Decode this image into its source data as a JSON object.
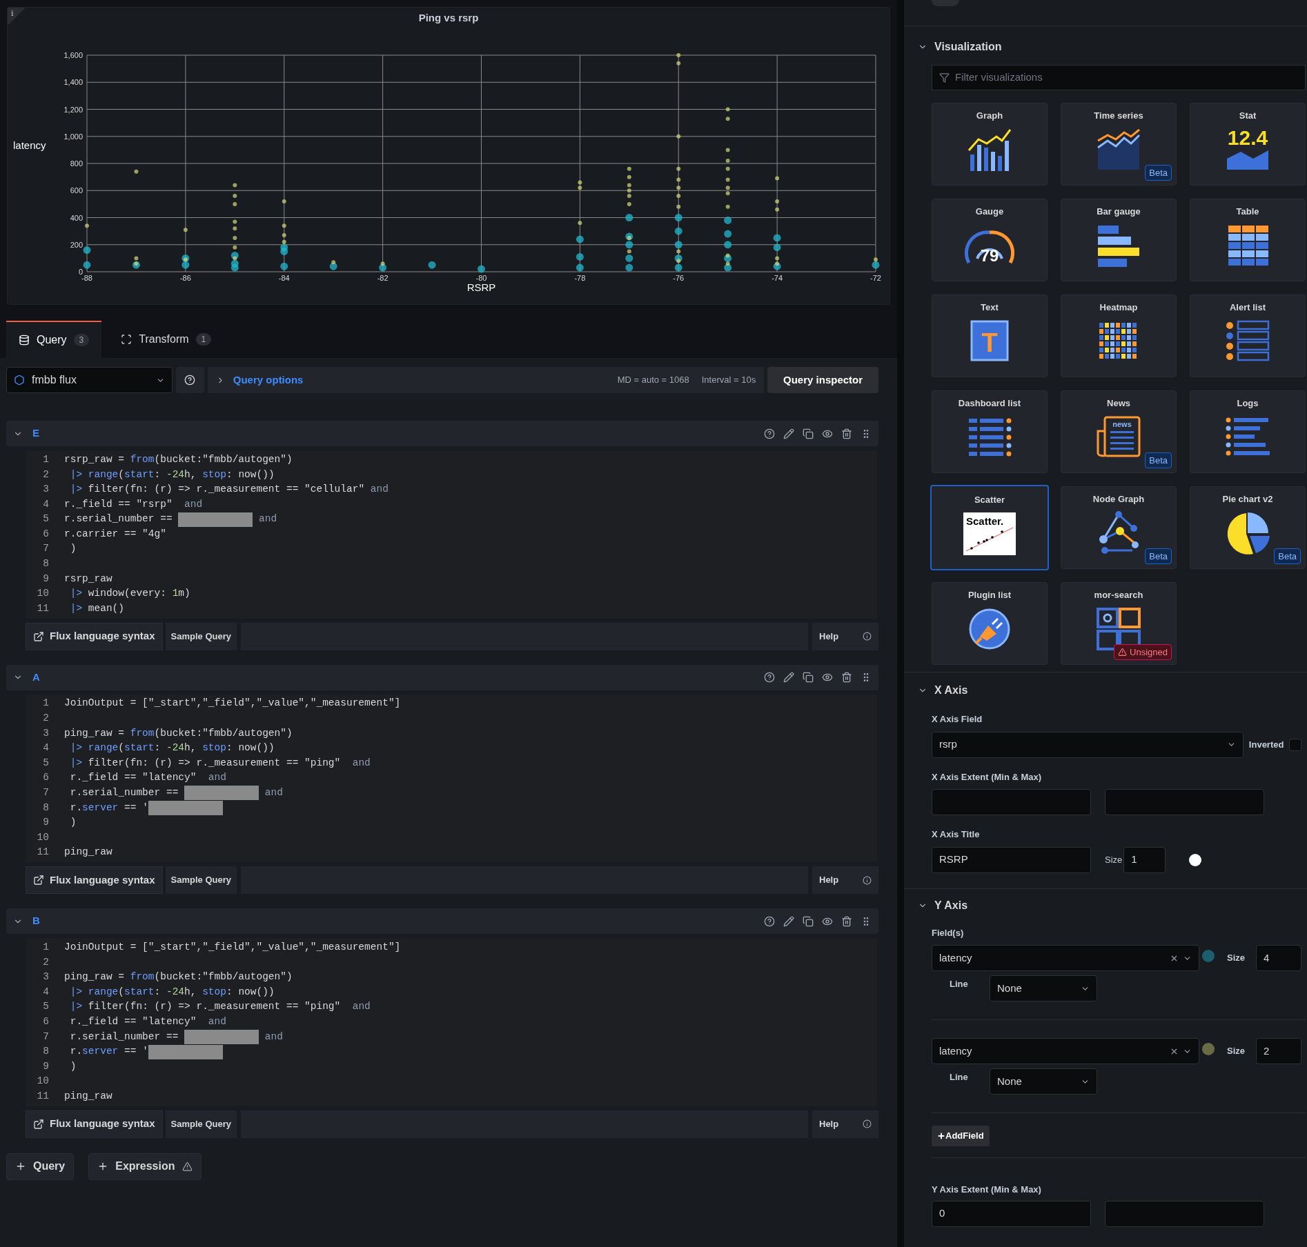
{
  "panel": {
    "info_mark": "i",
    "title": "Ping vs rsrp",
    "chart_data": {
      "type": "scatter",
      "xlabel": "RSRP",
      "ylabel": "latency",
      "grid": true,
      "xlim": [
        -88,
        -72
      ],
      "ylim": [
        0,
        1600
      ],
      "xticks": [
        -88,
        -86,
        -84,
        -82,
        -80,
        -78,
        -76,
        -74,
        -72
      ],
      "yticks": [
        {
          "value": 0,
          "label": "0"
        },
        {
          "value": 200,
          "label": "200"
        },
        {
          "value": 400,
          "label": "400"
        },
        {
          "value": 600,
          "label": "600"
        },
        {
          "value": 800,
          "label": "800"
        },
        {
          "value": 1000,
          "label": "1,000"
        },
        {
          "value": 1200,
          "label": "1,200"
        },
        {
          "value": 1400,
          "label": "1,400"
        },
        {
          "value": 1600,
          "label": "1,600"
        }
      ],
      "series": [
        {
          "color": "#22b8cf",
          "x": [
            -88,
            -88,
            -87,
            -86,
            -86,
            -85,
            -85,
            -85,
            -84,
            -84,
            -84,
            -83,
            -82,
            -81,
            -80,
            -78,
            -78,
            -78,
            -77,
            -77,
            -77,
            -77,
            -77,
            -76,
            -76,
            -76,
            -76,
            -76,
            -75,
            -75,
            -75,
            -75,
            -75,
            -74,
            -74,
            -74,
            -72
          ],
          "values": [
            50,
            160,
            50,
            50,
            100,
            30,
            60,
            120,
            40,
            150,
            180,
            40,
            30,
            50,
            20,
            30,
            110,
            240,
            30,
            100,
            200,
            260,
            400,
            30,
            100,
            200,
            300,
            400,
            30,
            100,
            200,
            280,
            380,
            40,
            180,
            250,
            50
          ]
        },
        {
          "color": "#d4d87e",
          "x": [
            -88,
            -87,
            -87,
            -87,
            -86,
            -86,
            -85,
            -85,
            -85,
            -85,
            -85,
            -85,
            -85,
            -85,
            -84,
            -84,
            -84,
            -84,
            -83,
            -82,
            -78,
            -78,
            -78,
            -77,
            -77,
            -77,
            -77,
            -77,
            -77,
            -77,
            -77,
            -76,
            -76,
            -76,
            -76,
            -76,
            -76,
            -76,
            -76,
            -76,
            -76,
            -75,
            -75,
            -75,
            -75,
            -75,
            -75,
            -75,
            -75,
            -75,
            -75,
            -75,
            -74,
            -74,
            -74,
            -74,
            -74,
            -72
          ],
          "values": [
            340,
            740,
            100,
            60,
            310,
            90,
            640,
            560,
            500,
            370,
            320,
            250,
            180,
            100,
            520,
            340,
            270,
            220,
            70,
            60,
            660,
            620,
            360,
            760,
            700,
            640,
            600,
            560,
            500,
            250,
            150,
            1600,
            1540,
            1000,
            760,
            680,
            620,
            560,
            480,
            150,
            80,
            1200,
            1130,
            900,
            820,
            760,
            680,
            620,
            580,
            480,
            120,
            60,
            690,
            520,
            460,
            100,
            60,
            90
          ]
        }
      ]
    }
  },
  "tabs": [
    {
      "label": "Query",
      "count": "3",
      "selected": true
    },
    {
      "label": "Transform",
      "count": "1",
      "selected": false
    }
  ],
  "datasource": {
    "name": "fmbb flux"
  },
  "query_options": {
    "label": "Query options",
    "expanded": false,
    "md": "MD = auto = 1068",
    "interval": "Interval = 10s",
    "inspector": "Query inspector"
  },
  "queries": [
    {
      "letter": "E",
      "expanded": true,
      "lines": [
        {
          "number": "1",
          "segments": [
            {
              "t": "rsrp_raw = "
            },
            {
              "t": "from",
              "kind": "keyword"
            },
            {
              "t": "(bucket:\"fmbb/autogen\")"
            }
          ]
        },
        {
          "number": "2",
          "segments": [
            {
              "t": " |> range",
              "kind": "keyword"
            },
            {
              "t": "("
            },
            {
              "t": "start",
              "kind": "keyword"
            },
            {
              "t": ": "
            },
            {
              "t": "-24",
              "kind": "number"
            },
            {
              "t": "h, "
            },
            {
              "t": "stop",
              "kind": "keyword"
            },
            {
              "t": ": now())"
            }
          ]
        },
        {
          "number": "3",
          "segments": [
            {
              "t": " |> ",
              "kind": "keyword"
            },
            {
              "t": "filter(fn: (r) => r._measurement == \"cellular\" "
            },
            {
              "t": "and",
              "kind": "muted"
            }
          ]
        },
        {
          "number": "4",
          "segments": [
            {
              "t": "r._field == \"rsrp\"  "
            },
            {
              "t": "and",
              "kind": "muted"
            }
          ]
        },
        {
          "number": "5",
          "segments": [
            {
              "t": "r.serial_number == "
            },
            {
              "kind": "redacted"
            },
            {
              "t": " and",
              "kind": "muted"
            }
          ]
        },
        {
          "number": "6",
          "segments": [
            {
              "t": "r.carrier == \"4g\""
            }
          ]
        },
        {
          "number": "7",
          "segments": [
            {
              "t": " )"
            }
          ]
        },
        {
          "number": "8"
        },
        {
          "number": "9",
          "segments": [
            {
              "t": "rsrp_raw"
            }
          ]
        },
        {
          "number": "10",
          "segments": [
            {
              "t": " |> ",
              "kind": "keyword"
            },
            {
              "t": "window(every: "
            },
            {
              "t": "1",
              "kind": "number"
            },
            {
              "t": "m)"
            }
          ]
        },
        {
          "number": "11",
          "segments": [
            {
              "t": " |> ",
              "kind": "keyword"
            },
            {
              "t": "mean()"
            }
          ]
        }
      ],
      "footer": {
        "syntax": "Flux language syntax",
        "sample": "Sample Query",
        "help": "Help"
      }
    },
    {
      "letter": "A",
      "expanded": true,
      "lines": [
        {
          "number": "1",
          "segments": [
            {
              "t": "JoinOutput = [\"_start\",\"_field\",\"_value\",\"_measurement\"]"
            }
          ]
        },
        {
          "number": "2"
        },
        {
          "number": "3",
          "segments": [
            {
              "t": "ping_raw = "
            },
            {
              "t": "from",
              "kind": "keyword"
            },
            {
              "t": "(bucket:\"fmbb/autogen\")"
            }
          ]
        },
        {
          "number": "4",
          "segments": [
            {
              "t": " |> range",
              "kind": "keyword"
            },
            {
              "t": "("
            },
            {
              "t": "start",
              "kind": "keyword"
            },
            {
              "t": ": "
            },
            {
              "t": "-24",
              "kind": "number"
            },
            {
              "t": "h, "
            },
            {
              "t": "stop",
              "kind": "keyword"
            },
            {
              "t": ": now())"
            }
          ]
        },
        {
          "number": "5",
          "segments": [
            {
              "t": " |> ",
              "kind": "keyword"
            },
            {
              "t": "filter(fn: (r) => r._measurement == \"ping\"  "
            },
            {
              "t": "and",
              "kind": "muted"
            }
          ]
        },
        {
          "number": "6",
          "segments": [
            {
              "t": " r._field == \"latency\"  "
            },
            {
              "t": "and",
              "kind": "muted"
            }
          ]
        },
        {
          "number": "7",
          "segments": [
            {
              "t": " r.serial_number == "
            },
            {
              "kind": "redacted"
            },
            {
              "t": " and",
              "kind": "muted"
            }
          ]
        },
        {
          "number": "8",
          "segments": [
            {
              "t": " r."
            },
            {
              "t": "server",
              "kind": "keyword"
            },
            {
              "t": " == '"
            },
            {
              "kind": "redacted"
            }
          ]
        },
        {
          "number": "9",
          "segments": [
            {
              "t": " )"
            }
          ]
        },
        {
          "number": "10"
        },
        {
          "number": "11",
          "segments": [
            {
              "t": "ping_raw"
            }
          ]
        }
      ],
      "footer": {
        "syntax": "Flux language syntax",
        "sample": "Sample Query",
        "help": "Help"
      }
    },
    {
      "letter": "B",
      "expanded": true,
      "lines": [
        {
          "number": "1",
          "segments": [
            {
              "t": "JoinOutput = [\"_start\",\"_field\",\"_value\",\"_measurement\"]"
            }
          ]
        },
        {
          "number": "2"
        },
        {
          "number": "3",
          "segments": [
            {
              "t": "ping_raw = "
            },
            {
              "t": "from",
              "kind": "keyword"
            },
            {
              "t": "(bucket:\"fmbb/autogen\")"
            }
          ]
        },
        {
          "number": "4",
          "segments": [
            {
              "t": " |> range",
              "kind": "keyword"
            },
            {
              "t": "("
            },
            {
              "t": "start",
              "kind": "keyword"
            },
            {
              "t": ": "
            },
            {
              "t": "-24",
              "kind": "number"
            },
            {
              "t": "h, "
            },
            {
              "t": "stop",
              "kind": "keyword"
            },
            {
              "t": ": now())"
            }
          ]
        },
        {
          "number": "5",
          "segments": [
            {
              "t": " |> ",
              "kind": "keyword"
            },
            {
              "t": "filter(fn: (r) => r._measurement == \"ping\"  "
            },
            {
              "t": "and",
              "kind": "muted"
            }
          ]
        },
        {
          "number": "6",
          "segments": [
            {
              "t": " r._field == \"latency\"  "
            },
            {
              "t": "and",
              "kind": "muted"
            }
          ]
        },
        {
          "number": "7",
          "segments": [
            {
              "t": " r.serial_number == "
            },
            {
              "kind": "redacted"
            },
            {
              "t": " and",
              "kind": "muted"
            }
          ]
        },
        {
          "number": "8",
          "segments": [
            {
              "t": " r."
            },
            {
              "t": "server",
              "kind": "keyword"
            },
            {
              "t": " == '"
            },
            {
              "kind": "redacted"
            }
          ]
        },
        {
          "number": "9",
          "segments": [
            {
              "t": " )"
            }
          ]
        },
        {
          "number": "10"
        },
        {
          "number": "11",
          "segments": [
            {
              "t": "ping_raw"
            }
          ]
        }
      ],
      "footer": {
        "syntax": "Flux language syntax",
        "sample": "Sample Query",
        "help": "Help"
      }
    }
  ],
  "add_buttons": [
    {
      "label": "Query",
      "warning": false
    },
    {
      "label": "Expression",
      "warning": true
    }
  ],
  "options": {
    "top_switch": {
      "on": false
    },
    "visualization": {
      "title": "Visualization",
      "expanded": true,
      "filter_placeholder": "Filter visualizations",
      "cards": [
        {
          "name": "Graph",
          "selected": false
        },
        {
          "name": "Time series",
          "selected": false,
          "badge": {
            "text": "Beta",
            "kind": "beta"
          }
        },
        {
          "name": "Stat",
          "selected": false,
          "icon_text": "12.4"
        },
        {
          "name": "Gauge",
          "selected": false,
          "icon_text": "79"
        },
        {
          "name": "Bar gauge",
          "selected": false
        },
        {
          "name": "Table",
          "selected": false
        },
        {
          "name": "Text",
          "selected": false,
          "icon_text": "T"
        },
        {
          "name": "Heatmap",
          "selected": false
        },
        {
          "name": "Alert list",
          "selected": false
        },
        {
          "name": "Dashboard list",
          "selected": false
        },
        {
          "name": "News",
          "selected": false,
          "icon_text": "news",
          "badge": {
            "text": "Beta",
            "kind": "beta"
          }
        },
        {
          "name": "Logs",
          "selected": false
        },
        {
          "name": "Scatter",
          "selected": true,
          "icon_text": "Scatter."
        },
        {
          "name": "Node Graph",
          "selected": false,
          "badge": {
            "text": "Beta",
            "kind": "beta"
          }
        },
        {
          "name": "Pie chart v2",
          "selected": false,
          "badge": {
            "text": "Beta",
            "kind": "beta"
          }
        },
        {
          "name": "Plugin list",
          "selected": false
        },
        {
          "name": "mor-search",
          "selected": false,
          "badge": {
            "text": "Unsigned",
            "kind": "warning"
          }
        }
      ]
    },
    "x_axis": {
      "title": "X Axis",
      "expanded": true,
      "field_label": "X Axis Field",
      "field": "rsrp",
      "inverted_label": "Inverted",
      "inverted": false,
      "extent_label": "X Axis Extent (Min & Max)",
      "axis_title_label": "X Axis Title",
      "axis_title": "RSRP",
      "size_label": "Size",
      "size": "1",
      "color": "#ffffff"
    },
    "y_axis": {
      "title": "Y Axis",
      "expanded": true,
      "fields_label": "Field(s)",
      "fields": [
        {
          "field": "latency",
          "color": "#1b5e6e",
          "size_label": "Size",
          "size": "4",
          "line_label": "Line",
          "line": "None"
        },
        {
          "field": "latency",
          "color": "#6b6b45",
          "size_label": "Size",
          "size": "2",
          "line_label": "Line",
          "line": "None"
        }
      ],
      "add_field": "AddField",
      "extent_label": "Y Axis Extent (Min & Max)",
      "extent_min": "0"
    }
  }
}
